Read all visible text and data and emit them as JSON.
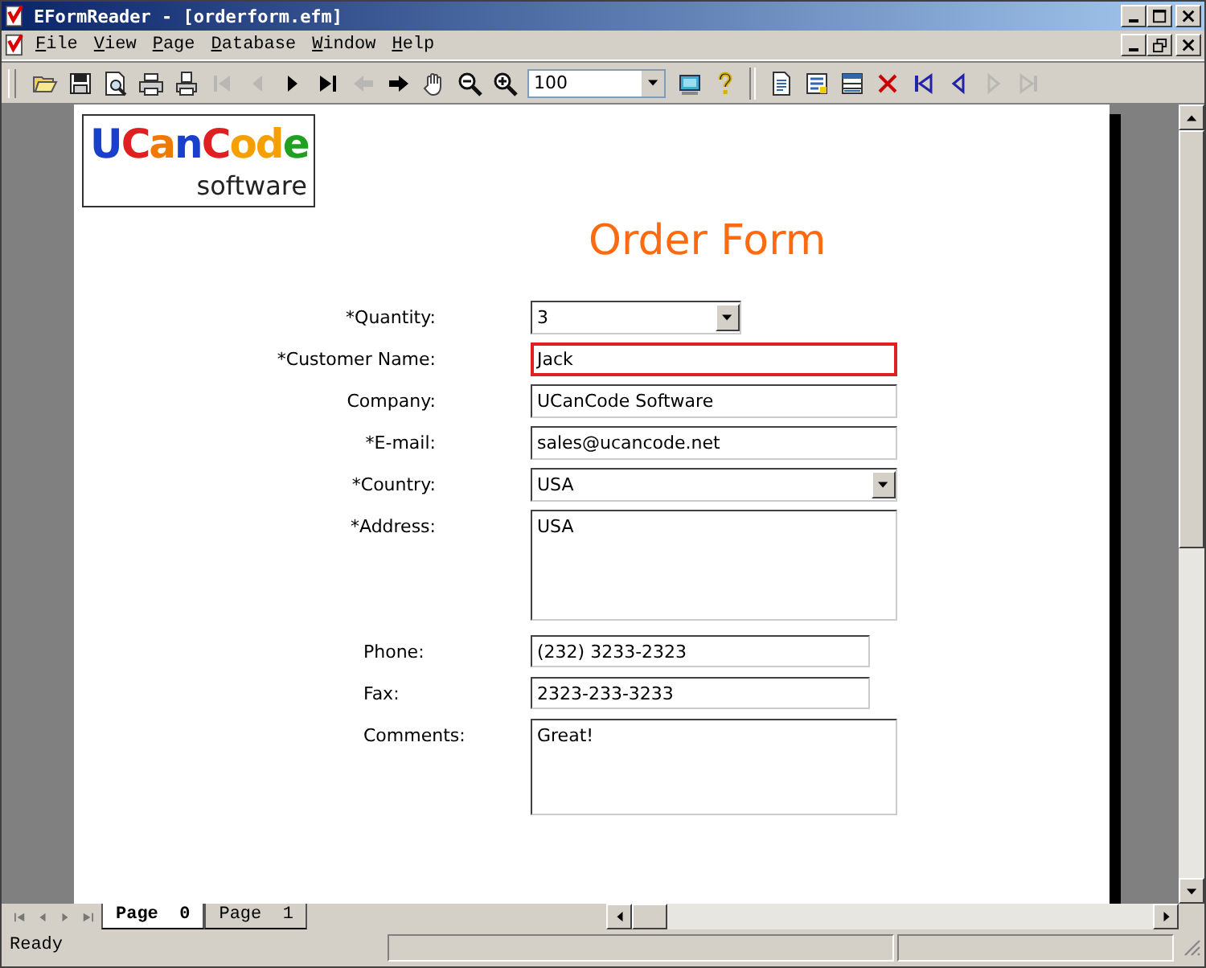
{
  "window": {
    "title": "EFormReader - [orderform.efm]"
  },
  "menu": [
    "File",
    "View",
    "Page",
    "Database",
    "Window",
    "Help"
  ],
  "toolbar": [
    {
      "kind": "button",
      "disabled": false
    },
    {
      "kind": "button",
      "disabled": false
    },
    {
      "kind": "button",
      "disabled": false
    },
    {
      "kind": "button",
      "disabled": false
    },
    {
      "kind": "button",
      "disabled": false
    },
    {
      "kind": "button",
      "disabled": true
    },
    {
      "kind": "button",
      "disabled": true
    },
    {
      "kind": "button",
      "disabled": false
    },
    {
      "kind": "button",
      "disabled": false
    },
    {
      "kind": "button",
      "disabled": true
    },
    {
      "kind": "button",
      "disabled": false
    },
    {
      "kind": "button",
      "disabled": false
    },
    {
      "kind": "button",
      "disabled": false
    },
    {
      "kind": "button",
      "disabled": false
    },
    {
      "kind": "combo",
      "value": "100"
    },
    {
      "kind": "button",
      "disabled": false
    },
    {
      "kind": "button",
      "disabled": false
    },
    {
      "kind": "separator"
    },
    {
      "kind": "button",
      "disabled": false
    },
    {
      "kind": "button",
      "disabled": false
    },
    {
      "kind": "button",
      "disabled": false
    },
    {
      "kind": "button",
      "disabled": false
    },
    {
      "kind": "button",
      "disabled": false
    },
    {
      "kind": "button",
      "disabled": false
    },
    {
      "kind": "button",
      "disabled": true
    },
    {
      "kind": "button",
      "disabled": true
    }
  ],
  "logo": {
    "letters": [
      {
        "text": "U",
        "color": "#1a3fcc"
      },
      {
        "text": "C",
        "color": "#e02020"
      },
      {
        "text": "a",
        "color": "#f07a00"
      },
      {
        "text": "n",
        "color": "#1a3fcc"
      },
      {
        "text": "C",
        "color": "#e02020"
      },
      {
        "text": "o",
        "color": "#f5a000"
      },
      {
        "text": "d",
        "color": "#f5a000"
      },
      {
        "text": "e",
        "color": "#20a020"
      }
    ],
    "subtitle": "software"
  },
  "form": {
    "title": "Order Form",
    "sections": [
      [
        {
          "label": "*Quantity:",
          "kind": "dropdown",
          "value": "3",
          "focused": false
        },
        {
          "label": "*Customer Name:",
          "kind": "text",
          "value": "Jack",
          "focused": true
        },
        {
          "label": "Company:",
          "kind": "text",
          "value": "UCanCode Software",
          "focused": false
        },
        {
          "label": "*E-mail:",
          "kind": "text",
          "value": "sales@ucancode.net",
          "focused": false
        },
        {
          "label": "*Country:",
          "kind": "dropdown",
          "value": "USA",
          "focused": false
        },
        {
          "label": "*Address:",
          "kind": "textarea",
          "value": "USA",
          "focused": false
        }
      ],
      [
        {
          "label": "Phone:",
          "kind": "text",
          "value": "(232) 3233-2323",
          "focused": false
        },
        {
          "label": "Fax:",
          "kind": "text",
          "value": "2323-233-3233",
          "focused": false
        },
        {
          "label": "Comments:",
          "kind": "textarea",
          "value": "Great!",
          "focused": false
        }
      ]
    ]
  },
  "page_tabs": [
    {
      "label": "Page  0",
      "selected": true
    },
    {
      "label": "Page  1",
      "selected": false
    }
  ],
  "status_bar": {
    "text": "Ready"
  }
}
